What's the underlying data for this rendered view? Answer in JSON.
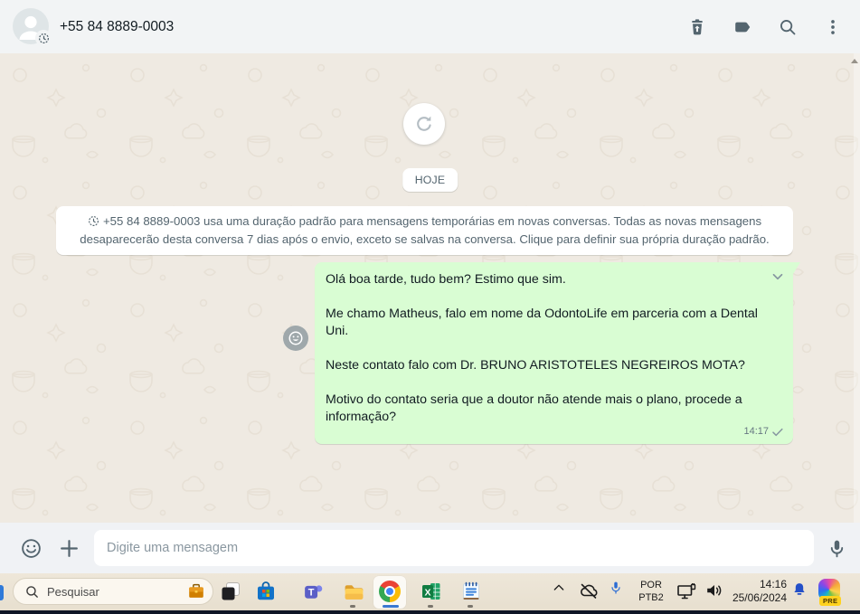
{
  "header": {
    "contact_title": "+55 84 8889-0003",
    "icons": [
      "delete-icon",
      "label-icon",
      "search-icon",
      "menu-kebab-icon"
    ],
    "avatar_badge": "disappearing-messages-timer"
  },
  "chat": {
    "refresh_button": "sync-older-messages",
    "date_badge": "HOJE",
    "disappearing_notice": "+55 84 8889-0003 usa uma duração padrão para mensagens temporárias em novas conversas. Todas as novas mensagens desaparecerão desta conversa 7 dias após o envio, exceto se salvas na conversa. Clique para definir sua própria duração padrão.",
    "message_outgoing": {
      "paragraphs": [
        "Olá boa tarde, tudo bem? Estimo que sim.",
        "Me chamo Matheus, falo em nome da OdontoLife em parceria com a Dental Uni.",
        "Neste contato falo com Dr. BRUNO ARISTOTELES NEGREIROS MOTA?",
        "Motivo do contato seria que a doutor não atende mais o plano, procede a informação?"
      ],
      "time": "14:17",
      "status": "sent-one-check"
    }
  },
  "composer": {
    "placeholder": "Digite uma mensagem",
    "icons": [
      "emoji-icon",
      "plus-icon",
      "mic-icon"
    ]
  },
  "taskbar": {
    "search_label": "Pesquisar",
    "apps": [
      "task-view",
      "microsoft-store",
      "teams",
      "file-explorer",
      "chrome",
      "excel",
      "notepad"
    ],
    "tray": [
      "hidden-icons-chevron",
      "onedrive-offline",
      "microphone-in-use",
      "language",
      "display-connect",
      "volume"
    ],
    "language_line1": "POR",
    "language_line2": "PTB2",
    "time": "14:16",
    "date": "25/06/2024",
    "copilot_badge": "PRE"
  },
  "colors": {
    "bubble_green": "#d9fdd3",
    "chat_background": "#efeae2",
    "panel_background": "#f0f2f5",
    "icon_slate": "#54656f",
    "taskbar_beige": "#ece5d6",
    "chrome_active_underline": "#3b78d1",
    "bell_blue": "#2450c8",
    "copilot_badge_yellow": "#ffd21e"
  }
}
